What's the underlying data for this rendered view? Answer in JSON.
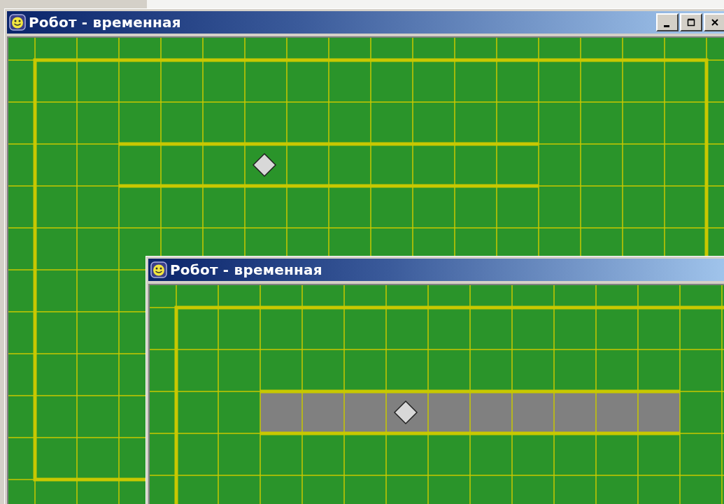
{
  "windows": [
    {
      "title": "Робот - временная",
      "controls": true,
      "field": {
        "painted": false
      }
    },
    {
      "title": "Робот - временная",
      "controls": false,
      "field": {
        "painted": true
      }
    }
  ]
}
